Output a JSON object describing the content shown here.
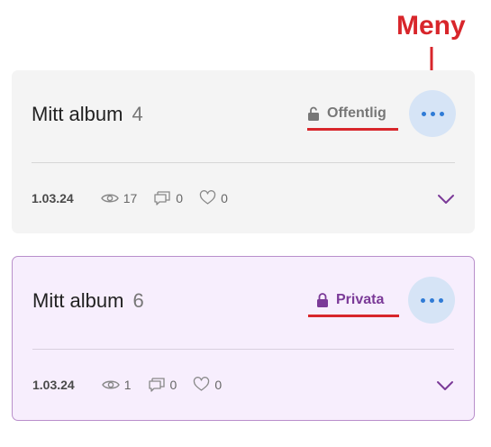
{
  "annotation": {
    "label": "Meny",
    "color": "#d8262b"
  },
  "albums": [
    {
      "title": "Mitt album",
      "count": "4",
      "privacy": "Offentlig",
      "privacy_icon": "lock-open-icon",
      "date": "1.03.24",
      "views": "17",
      "comments": "0",
      "likes": "0",
      "background": "#f4f4f4"
    },
    {
      "title": "Mitt album",
      "count": "6",
      "privacy": "Privata",
      "privacy_icon": "lock-icon",
      "date": "1.03.24",
      "views": "1",
      "comments": "0",
      "likes": "0",
      "background": "#f7eefd",
      "accent": "#7b3a98"
    }
  ]
}
